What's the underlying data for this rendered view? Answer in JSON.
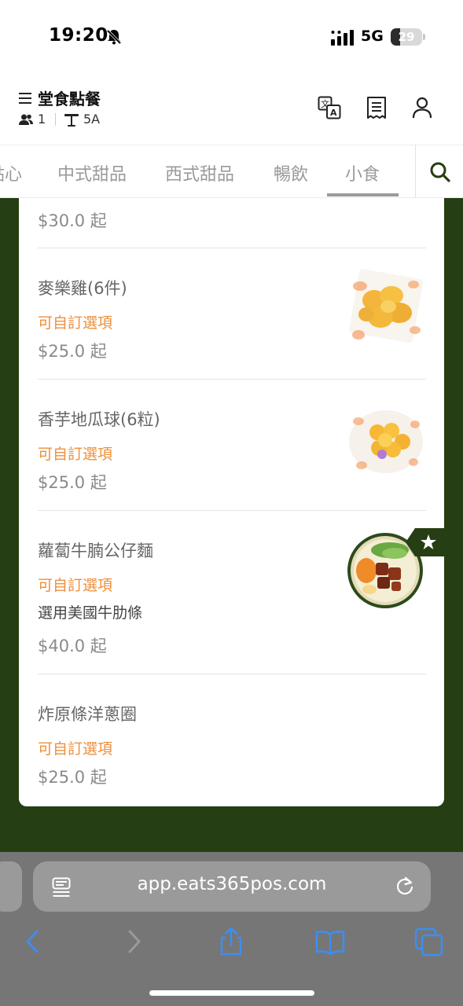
{
  "status_bar": {
    "time": "19:20",
    "network": "5G",
    "battery_level": "29",
    "battery_fraction": 0.29,
    "icons": [
      "bell-slash-icon",
      "signal-icon"
    ]
  },
  "header": {
    "title": "堂食點餐",
    "guests": "1",
    "table": "5A",
    "icons": [
      "menu-icon",
      "guests-icon",
      "table-icon",
      "translate-icon",
      "receipt-icon",
      "account-icon"
    ]
  },
  "tabs": {
    "items": [
      "點心",
      "中式甜品",
      "西式甜品",
      "暢飲",
      "小食"
    ],
    "selected": "小食",
    "search_icon": "search-icon"
  },
  "menu": {
    "top_price": "$30.0 起",
    "items": [
      {
        "name": "麥樂雞(6件)",
        "option": "可自訂選項",
        "price": "$25.0 起"
      },
      {
        "name": "香芋地瓜球(6粒)",
        "option": "可自訂選項",
        "price": "$25.0 起"
      },
      {
        "name": "蘿蔔牛腩公仔麵",
        "option": "可自訂選項",
        "description": "選用美國牛肋條",
        "price": "$40.0 起",
        "badge": "star-icon"
      },
      {
        "name": "炸原條洋蔥圈",
        "option": "可自訂選項",
        "price": "$25.0 起"
      }
    ]
  },
  "browser": {
    "url": "app.eats365pos.com",
    "icons": [
      "reader-icon",
      "reload-icon",
      "back-icon",
      "forward-icon",
      "share-icon",
      "bookmarks-icon",
      "tabs-icon"
    ]
  },
  "colors": {
    "brand_green": "#263e13",
    "option_orange": "#ee8f3c",
    "ios_blue": "#3d8ef0"
  }
}
